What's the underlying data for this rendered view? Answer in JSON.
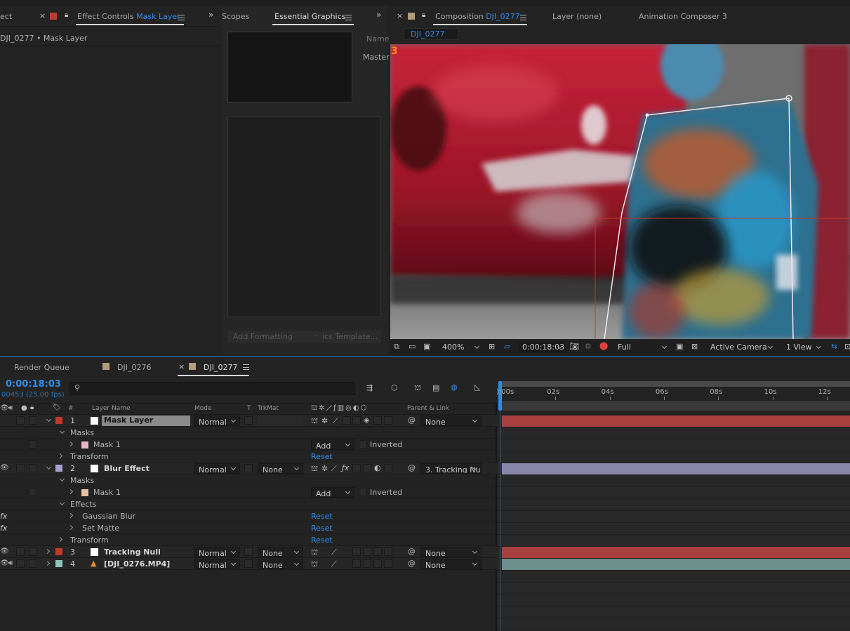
{
  "effect_controls": {
    "tab_prefix": "ect",
    "title": "Effect Controls",
    "title_layer": "Mask Layer",
    "subtitle": "DJI_0277 • Mask Layer"
  },
  "eg_panel": {
    "tab_scopes": "Scopes",
    "tab_essential": "Essential Graphics",
    "label_name": "Name",
    "label_master": "Master",
    "add_formatting": "Add Formatting",
    "template": "ics Template..."
  },
  "composition": {
    "tab_prefix": "Composition",
    "tab_name": "DJI_0277",
    "tab_layer": "Layer (none)",
    "tab_anim": "Animation Composer 3",
    "subtab": "DJI_0277",
    "badge": "3"
  },
  "viewer_bar": {
    "zoom": "400%",
    "timecode": "0:00:18:03",
    "quality": "Full",
    "camera": "Active Camera",
    "views": "1 View"
  },
  "timeline_tabs": {
    "render_queue": "Render Queue",
    "comp1": "DJI_0276",
    "comp2": "DJI_0277"
  },
  "timeline": {
    "timecode": "0:00:18:03",
    "frames": "00453 (25.00 fps)",
    "search_placeholder": "",
    "columns": {
      "hash": "#",
      "layer_name": "Layer Name",
      "mode": "Mode",
      "t": "T",
      "trkmat": "TrkMat",
      "parent": "Parent & Link"
    },
    "ruler": [
      "):00s",
      "02s",
      "04s",
      "06s",
      "08s",
      "10s",
      "12s"
    ],
    "layers": {
      "l1": {
        "num": "1",
        "name": "Mask Layer",
        "mode": "Normal",
        "parent": "None"
      },
      "l1_masks": "Masks",
      "l1_mask1": "Mask 1",
      "l1_mask1_mode": "Add",
      "l1_mask1_inv": "Inverted",
      "l1_transform": "Transform",
      "l1_transform_reset": "Reset",
      "l2": {
        "num": "2",
        "name": "Blur Effect",
        "mode": "Normal",
        "trkmat": "None",
        "parent": "3. Tracking Nu"
      },
      "l2_masks": "Masks",
      "l2_mask1": "Mask 1",
      "l2_mask1_mode": "Add",
      "l2_mask1_inv": "Inverted",
      "l2_effects": "Effects",
      "l2_fx1": "Gaussian Blur",
      "l2_fx1_reset": "Reset",
      "l2_fx2": "Set Matte",
      "l2_fx2_reset": "Reset",
      "l2_transform": "Transform",
      "l2_transform_reset": "Reset",
      "l3": {
        "num": "3",
        "name": "Tracking Null",
        "mode": "Normal",
        "trkmat": "None",
        "parent": "None"
      },
      "l4": {
        "num": "4",
        "name": "[DJI_0276.MP4]",
        "mode": "Normal",
        "trkmat": "None",
        "parent": "None"
      },
      "fx_label": "fx"
    }
  },
  "colors": {
    "accent_blue": "#2d8ceb",
    "label_red": "#c0392b",
    "label_lavender": "#a8a0cc",
    "label_peach": "#e8c0a0",
    "label_pink": "#e8b8c8",
    "label_teal": "#8fc4bc",
    "bar_red": "#a8403f",
    "bar_lavender": "#8a86a8",
    "bar_teal": "#6e8f8c"
  }
}
